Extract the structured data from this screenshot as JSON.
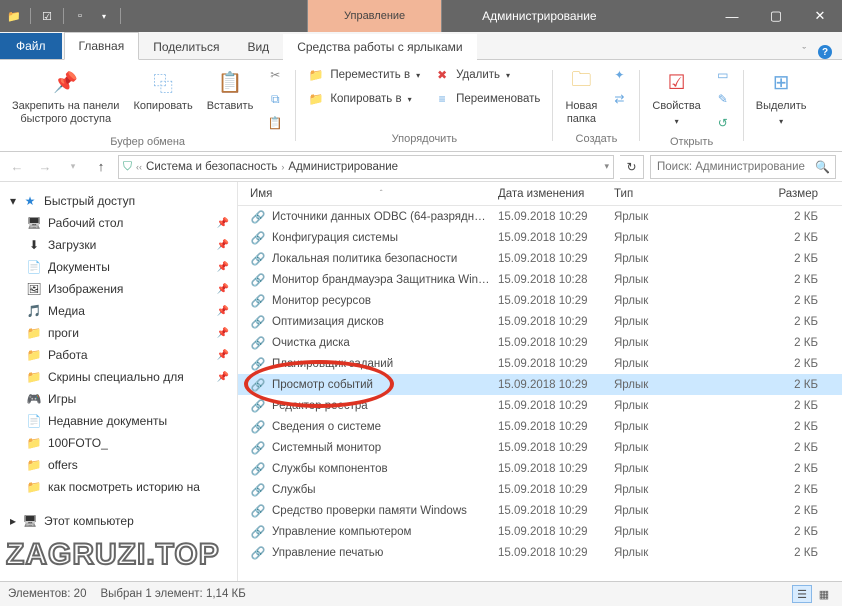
{
  "title": {
    "context_tab": "Управление",
    "window": "Администрирование"
  },
  "tabs": {
    "file": "Файл",
    "home": "Главная",
    "share": "Поделиться",
    "view": "Вид",
    "shortcut_tools": "Средства работы с ярлыками"
  },
  "ribbon": {
    "clipboard": {
      "label": "Буфер обмена",
      "pin": "Закрепить на панели\nбыстрого доступа",
      "copy": "Копировать",
      "paste": "Вставить"
    },
    "organize": {
      "label": "Упорядочить",
      "move_to": "Переместить в",
      "copy_to": "Копировать в",
      "delete": "Удалить",
      "rename": "Переименовать"
    },
    "new": {
      "label": "Создать",
      "folder": "Новая\nпапка"
    },
    "open": {
      "label": "Открыть",
      "properties": "Свойства"
    },
    "select": {
      "label": "",
      "select": "Выделить"
    }
  },
  "address": {
    "root": "Система и безопасность",
    "current": "Администрирование"
  },
  "search": {
    "placeholder": "Поиск: Администрирование"
  },
  "columns": {
    "name": "Имя",
    "date": "Дата изменения",
    "type": "Тип",
    "size": "Размер"
  },
  "nav": {
    "quick": "Быстрый доступ",
    "items": [
      {
        "icon": "🖥",
        "label": "Рабочий стол",
        "pin": true
      },
      {
        "icon": "⬇",
        "label": "Загрузки",
        "pin": true
      },
      {
        "icon": "📄",
        "label": "Документы",
        "pin": true
      },
      {
        "icon": "🖼",
        "label": "Изображения",
        "pin": true
      },
      {
        "icon": "🎵",
        "label": "Медиа",
        "pin": true
      },
      {
        "icon": "📁",
        "label": "проги",
        "pin": true
      },
      {
        "icon": "📁",
        "label": "Работа",
        "pin": true
      },
      {
        "icon": "📁",
        "label": "Скрины специально для",
        "pin": true
      },
      {
        "icon": "🎮",
        "label": "Игры",
        "pin": false
      },
      {
        "icon": "📄",
        "label": "Недавние документы",
        "pin": false
      },
      {
        "icon": "📁",
        "label": "100FOTO_",
        "pin": false
      },
      {
        "icon": "📁",
        "label": "offers",
        "pin": false
      },
      {
        "icon": "📁",
        "label": "как посмотреть историю на",
        "pin": false
      }
    ],
    "this_pc": "Этот компьютер"
  },
  "files": [
    {
      "name": "Источники данных ODBC (64-разрядн…",
      "date": "15.09.2018 10:29",
      "type": "Ярлык",
      "size": "2 КБ"
    },
    {
      "name": "Конфигурация системы",
      "date": "15.09.2018 10:29",
      "type": "Ярлык",
      "size": "2 КБ"
    },
    {
      "name": "Локальная политика безопасности",
      "date": "15.09.2018 10:29",
      "type": "Ярлык",
      "size": "2 КБ"
    },
    {
      "name": "Монитор брандмауэра Защитника Win…",
      "date": "15.09.2018 10:28",
      "type": "Ярлык",
      "size": "2 КБ"
    },
    {
      "name": "Монитор ресурсов",
      "date": "15.09.2018 10:29",
      "type": "Ярлык",
      "size": "2 КБ"
    },
    {
      "name": "Оптимизация дисков",
      "date": "15.09.2018 10:29",
      "type": "Ярлык",
      "size": "2 КБ"
    },
    {
      "name": "Очистка диска",
      "date": "15.09.2018 10:29",
      "type": "Ярлык",
      "size": "2 КБ"
    },
    {
      "name": "Планировщик заданий",
      "date": "15.09.2018 10:29",
      "type": "Ярлык",
      "size": "2 КБ"
    },
    {
      "name": "Просмотр событий",
      "date": "15.09.2018 10:29",
      "type": "Ярлык",
      "size": "2 КБ",
      "selected": true
    },
    {
      "name": "Редактор реестра",
      "date": "15.09.2018 10:29",
      "type": "Ярлык",
      "size": "2 КБ"
    },
    {
      "name": "Сведения о системе",
      "date": "15.09.2018 10:29",
      "type": "Ярлык",
      "size": "2 КБ"
    },
    {
      "name": "Системный монитор",
      "date": "15.09.2018 10:29",
      "type": "Ярлык",
      "size": "2 КБ"
    },
    {
      "name": "Службы компонентов",
      "date": "15.09.2018 10:29",
      "type": "Ярлык",
      "size": "2 КБ"
    },
    {
      "name": "Службы",
      "date": "15.09.2018 10:29",
      "type": "Ярлык",
      "size": "2 КБ"
    },
    {
      "name": "Средство проверки памяти Windows",
      "date": "15.09.2018 10:29",
      "type": "Ярлык",
      "size": "2 КБ"
    },
    {
      "name": "Управление компьютером",
      "date": "15.09.2018 10:29",
      "type": "Ярлык",
      "size": "2 КБ"
    },
    {
      "name": "Управление печатью",
      "date": "15.09.2018 10:29",
      "type": "Ярлык",
      "size": "2 КБ"
    }
  ],
  "status": {
    "count": "Элементов: 20",
    "selection": "Выбран 1 элемент: 1,14 КБ"
  },
  "watermark": "ZAGRUZI.TOP"
}
